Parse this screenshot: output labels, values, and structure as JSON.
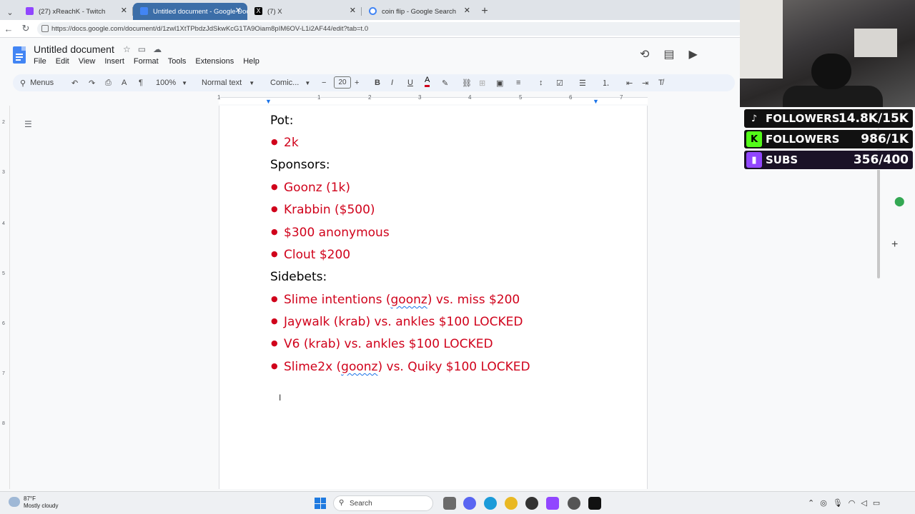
{
  "browser": {
    "tabs": [
      {
        "label": "(27) xReachK - Twitch",
        "active": false
      },
      {
        "label": "Untitled document - Google Docs",
        "active": true
      },
      {
        "label": "(7) X",
        "active": false
      },
      {
        "label": "coin flip - Google Search",
        "active": false
      }
    ],
    "new_tab": "+",
    "url": "https://docs.google.com/document/d/1zwl1XtTPbdzJdSkwKcG1TA9Oiam8pIM6OV-L1i2AF44/edit?tab=t.0"
  },
  "docs": {
    "title": "Untitled document",
    "menu": [
      "File",
      "Edit",
      "View",
      "Insert",
      "Format",
      "Tools",
      "Extensions",
      "Help"
    ],
    "toolbar": {
      "menus_label": "Menus",
      "zoom": "100%",
      "style": "Normal text",
      "font": "Comic...",
      "font_size": "20"
    },
    "ruler_numbers": [
      "1",
      "1",
      "2",
      "3",
      "4",
      "5",
      "6",
      "7"
    ],
    "vruler_numbers": [
      "2",
      "3",
      "4",
      "5",
      "6",
      "7",
      "8"
    ]
  },
  "document": {
    "pot_heading": "Pot:",
    "pot_items": [
      "2k"
    ],
    "sponsors_heading": "Sponsors:",
    "sponsor_items": [
      "Goonz (1k)",
      "Krabbin ($500)",
      "$300 anonymous",
      "Clout $200"
    ],
    "sidebets_heading": "Sidebets:",
    "sidebet_items": [
      {
        "pre": "Slime intentions (",
        "flag": "goonz",
        "post": ") vs. miss $200"
      },
      {
        "pre": "Jaywalk (krab) vs. ankles $100 LOCKED",
        "flag": "",
        "post": ""
      },
      {
        "pre": "V6 (krab) vs. ankles $100 LOCKED",
        "flag": "",
        "post": ""
      },
      {
        "pre": "Slime2x (",
        "flag": "goonz",
        "post": ") vs. Quiky $100 LOCKED"
      }
    ],
    "text_color": "#d0021b"
  },
  "overlay": {
    "stats": [
      {
        "label": "FOLLOWERS",
        "value": "14.8K/15K",
        "icon": "tiktok-icon",
        "color": "#111111"
      },
      {
        "label": "FOLLOWERS",
        "value": "986/1K",
        "icon": "kick-icon",
        "color": "#53fc18"
      },
      {
        "label": "SUBS",
        "value": "356/400",
        "icon": "twitch-icon",
        "color": "#9146ff"
      }
    ]
  },
  "taskbar": {
    "temperature": "87°F",
    "condition": "Mostly cloudy",
    "search_label": "Search"
  }
}
